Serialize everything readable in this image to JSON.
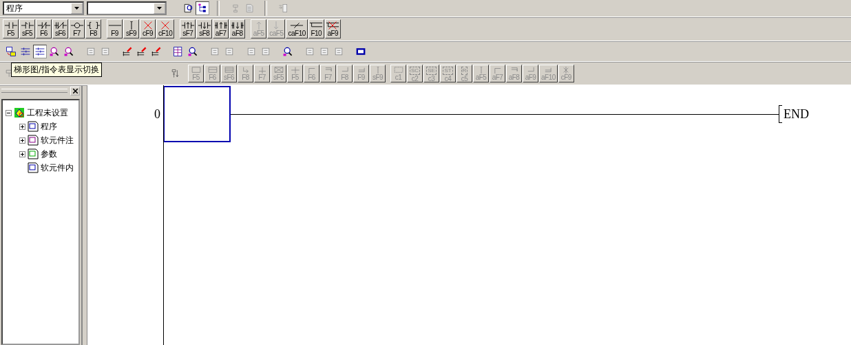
{
  "toolbar": {
    "program_combo": {
      "value": "程序"
    }
  },
  "ladder_keys": [
    {
      "key": "F5",
      "kind": "contact",
      "disabled": false
    },
    {
      "key": "sF5",
      "kind": "contact_par",
      "disabled": false
    },
    {
      "key": "F6",
      "kind": "contact_nc",
      "disabled": false
    },
    {
      "key": "sF6",
      "kind": "contact_nc_par",
      "disabled": false
    },
    {
      "key": "F7",
      "kind": "coil",
      "disabled": false
    },
    {
      "key": "F8",
      "kind": "instruction",
      "disabled": false
    },
    {
      "key": "F9",
      "kind": "hline",
      "disabled": false
    },
    {
      "key": "sF9",
      "kind": "vline",
      "disabled": false
    },
    {
      "key": "cF9",
      "kind": "hline_delete",
      "disabled": false
    },
    {
      "key": "cF10",
      "kind": "vline_delete",
      "disabled": false
    },
    {
      "key": "sF7",
      "kind": "pulse_up",
      "disabled": false
    },
    {
      "key": "sF8",
      "kind": "pulse_down",
      "disabled": false
    },
    {
      "key": "aF7",
      "kind": "pulse_up_par",
      "disabled": false
    },
    {
      "key": "aF8",
      "kind": "pulse_down_par",
      "disabled": false
    },
    {
      "key": "aF5",
      "kind": "arrow_up",
      "disabled": true
    },
    {
      "key": "caF5",
      "kind": "arrow_down",
      "disabled": true
    },
    {
      "key": "caF10",
      "kind": "invert",
      "disabled": false
    },
    {
      "key": "F10",
      "kind": "line_write",
      "disabled": false
    },
    {
      "key": "aF9",
      "kind": "line_delete",
      "disabled": false
    }
  ],
  "tooltip": "梯形图/指令表显示切换",
  "sfc_keys": [
    {
      "key": "F5",
      "kind": "box",
      "disabled": true
    },
    {
      "key": "F6",
      "kind": "box2",
      "disabled": true
    },
    {
      "key": "sF6",
      "kind": "box3",
      "disabled": true
    },
    {
      "key": "F8",
      "kind": "jump",
      "disabled": true
    },
    {
      "key": "F7",
      "kind": "transition",
      "disabled": true
    },
    {
      "key": "sF5",
      "kind": "end_box",
      "disabled": true
    },
    {
      "key": "F5",
      "kind": "cross",
      "disabled": true
    },
    {
      "key": "F6",
      "kind": "branch",
      "disabled": true
    },
    {
      "key": "F7",
      "kind": "branch2",
      "disabled": true
    },
    {
      "key": "F8",
      "kind": "join",
      "disabled": true
    },
    {
      "key": "F9",
      "kind": "join2",
      "disabled": true
    },
    {
      "key": "sF9",
      "kind": "vline",
      "disabled": true
    },
    {
      "key": "c1",
      "kind": "dashed",
      "disabled": true
    },
    {
      "key": "c2",
      "kind": "tag",
      "tag": "SC",
      "disabled": true
    },
    {
      "key": "c3",
      "kind": "tag",
      "tag": "SE",
      "disabled": true
    },
    {
      "key": "c4",
      "kind": "tag",
      "tag": "ST",
      "disabled": true
    },
    {
      "key": "c5",
      "kind": "tag",
      "tag": "R",
      "disabled": true
    },
    {
      "key": "aF5",
      "kind": "vline",
      "disabled": true
    },
    {
      "key": "aF7",
      "kind": "branch",
      "disabled": true
    },
    {
      "key": "aF8",
      "kind": "branch2",
      "disabled": true
    },
    {
      "key": "aF9",
      "kind": "join",
      "disabled": true
    },
    {
      "key": "aF10",
      "kind": "join2",
      "disabled": true
    },
    {
      "key": "cF9",
      "kind": "xline",
      "disabled": true
    }
  ],
  "project_tree": [
    {
      "label": "工程未设置",
      "expanded": true,
      "children": [
        {
          "label": "程序",
          "expanded": false
        },
        {
          "label": "软元件注",
          "expanded": false
        },
        {
          "label": "参数",
          "expanded": false
        },
        {
          "label": "软元件内"
        }
      ]
    }
  ],
  "ladder": {
    "rungs": [
      {
        "step": "0"
      }
    ],
    "end_label": "END"
  }
}
